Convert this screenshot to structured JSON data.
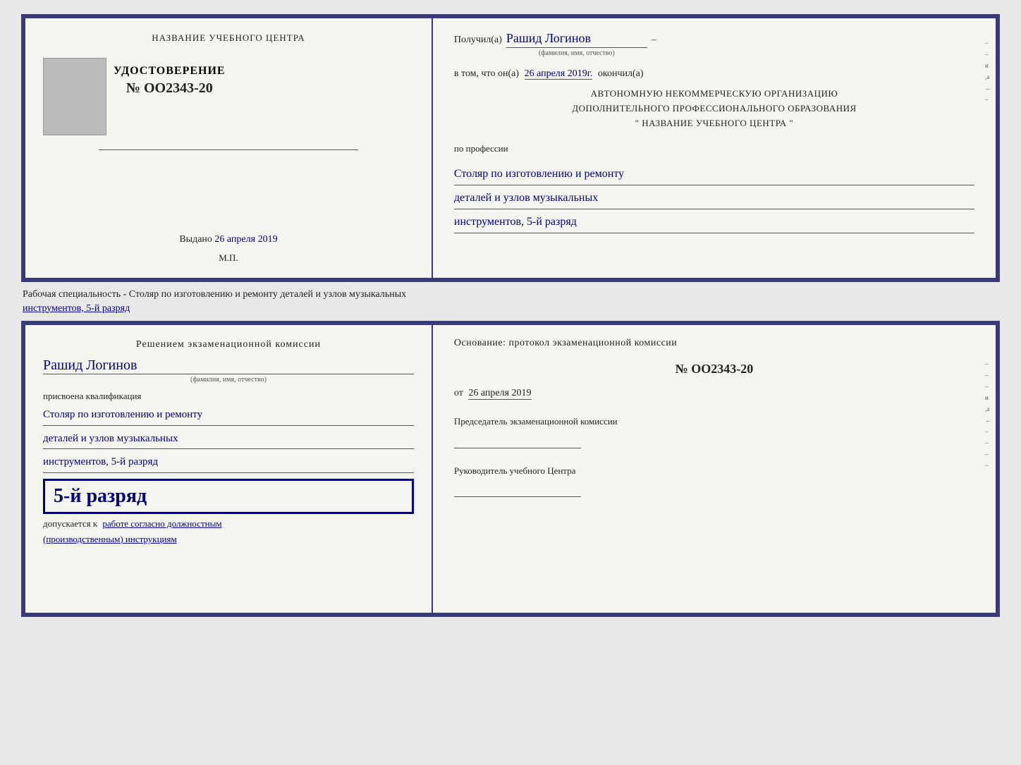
{
  "cert_top": {
    "left": {
      "center_title": "НАЗВАНИЕ УЧЕБНОГО ЦЕНТРА",
      "cert_label": "УДОСТОВЕРЕНИЕ",
      "cert_number": "№ OO2343-20",
      "issued_label": "Выдано",
      "issued_date": "26 апреля 2019",
      "mp_label": "М.П."
    },
    "right": {
      "recipient_prefix": "Получил(а)",
      "recipient_name": "Рашид Логинов",
      "fio_sublabel": "(фамилия, имя, отчество)",
      "date_prefix": "в том, что он(а)",
      "date_value": "26 апреля 2019г.",
      "date_suffix": "окончил(а)",
      "org_line1": "АВТОНОМНУЮ НЕКОММЕРЧЕСКУЮ ОРГАНИЗАЦИЮ",
      "org_line2": "ДОПОЛНИТЕЛЬНОГО ПРОФЕССИОНАЛЬНОГО ОБРАЗОВАНИЯ",
      "org_line3": "\"    НАЗВАНИЕ УЧЕБНОГО ЦЕНТРА    \"",
      "profession_prefix": "по профессии",
      "profession_line1": "Столяр по изготовлению и ремонту",
      "profession_line2": "деталей и узлов музыкальных",
      "profession_line3": "инструментов, 5-й разряд"
    }
  },
  "between": {
    "text": "Рабочая специальность - Столяр по изготовлению и ремонту деталей и узлов музыкальных",
    "underline_text": "инструментов, 5-й разряд"
  },
  "cert_bottom": {
    "left": {
      "commission_title": "Решением экзаменационной комиссии",
      "person_name": "Рашид Логинов",
      "fio_sublabel": "(фамилия, имя, отчество)",
      "qualification_label": "присвоена квалификация",
      "qualification_line1": "Столяр по изготовлению и ремонту",
      "qualification_line2": "деталей и узлов музыкальных",
      "qualification_line3": "инструментов, 5-й разряд",
      "rank_text": "5-й разряд",
      "allows_prefix": "допускается к",
      "allows_text": "работе согласно должностным",
      "allows_text2": "(производственным) инструкциям"
    },
    "right": {
      "basis_label": "Основание: протокол экзаменационной комиссии",
      "protocol_number": "№ OO2343-20",
      "date_prefix": "от",
      "date_value": "26 апреля 2019",
      "chairman_title": "Председатель экзаменационной комиссии",
      "head_title": "Руководитель учебного Центра"
    }
  }
}
